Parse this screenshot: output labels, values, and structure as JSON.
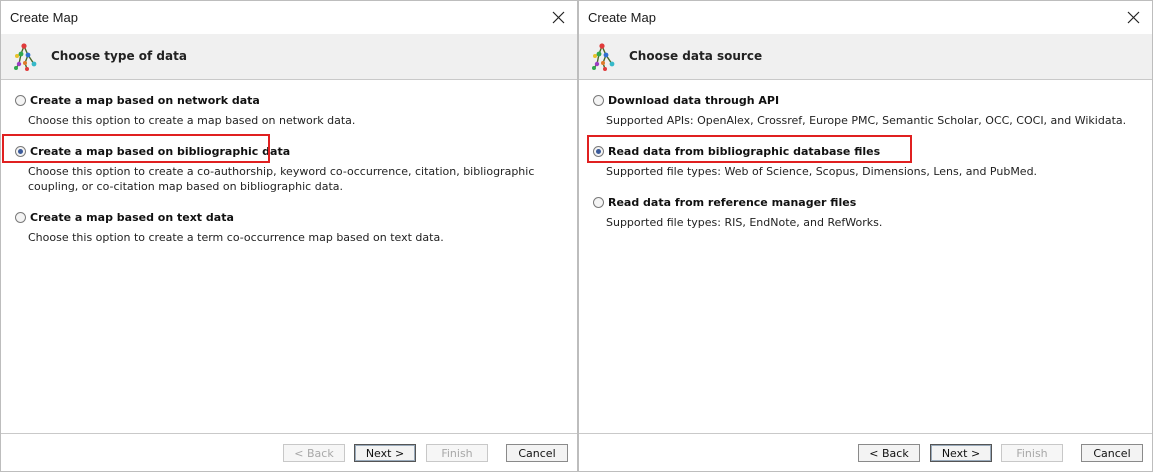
{
  "left_dialog": {
    "window_title": "Create Map",
    "header_title": "Choose type of data",
    "options": [
      {
        "label": "Create a map based on network data",
        "description": "Choose this option to create a map based on network data.",
        "selected": false
      },
      {
        "label": "Create a map based on bibliographic data",
        "description": "Choose this option to create a co-authorship, keyword co-occurrence, citation, bibliographic coupling, or co-citation map based on bibliographic data.",
        "selected": true
      },
      {
        "label": "Create a map based on text data",
        "description": "Choose this option to create a term co-occurrence map based on text data.",
        "selected": false
      }
    ],
    "buttons": {
      "back": "< Back",
      "next": "Next >",
      "finish": "Finish",
      "cancel": "Cancel"
    }
  },
  "right_dialog": {
    "window_title": "Create Map",
    "header_title": "Choose data source",
    "options": [
      {
        "label": "Download data through API",
        "description": "Supported APIs: OpenAlex, Crossref, Europe PMC, Semantic Scholar, OCC, COCI, and Wikidata.",
        "selected": false
      },
      {
        "label": "Read data from bibliographic database files",
        "description": "Supported file types: Web of Science, Scopus, Dimensions, Lens, and PubMed.",
        "selected": true
      },
      {
        "label": "Read data from reference manager files",
        "description": "Supported file types: RIS, EndNote, and RefWorks.",
        "selected": false
      }
    ],
    "buttons": {
      "back": "< Back",
      "next": "Next >",
      "finish": "Finish",
      "cancel": "Cancel"
    }
  },
  "colors": {
    "highlight_box": "#e02020",
    "header_background": "#f0f0f0"
  },
  "icons": {
    "close": "close-icon",
    "header": "vosviewer-map-icon"
  }
}
